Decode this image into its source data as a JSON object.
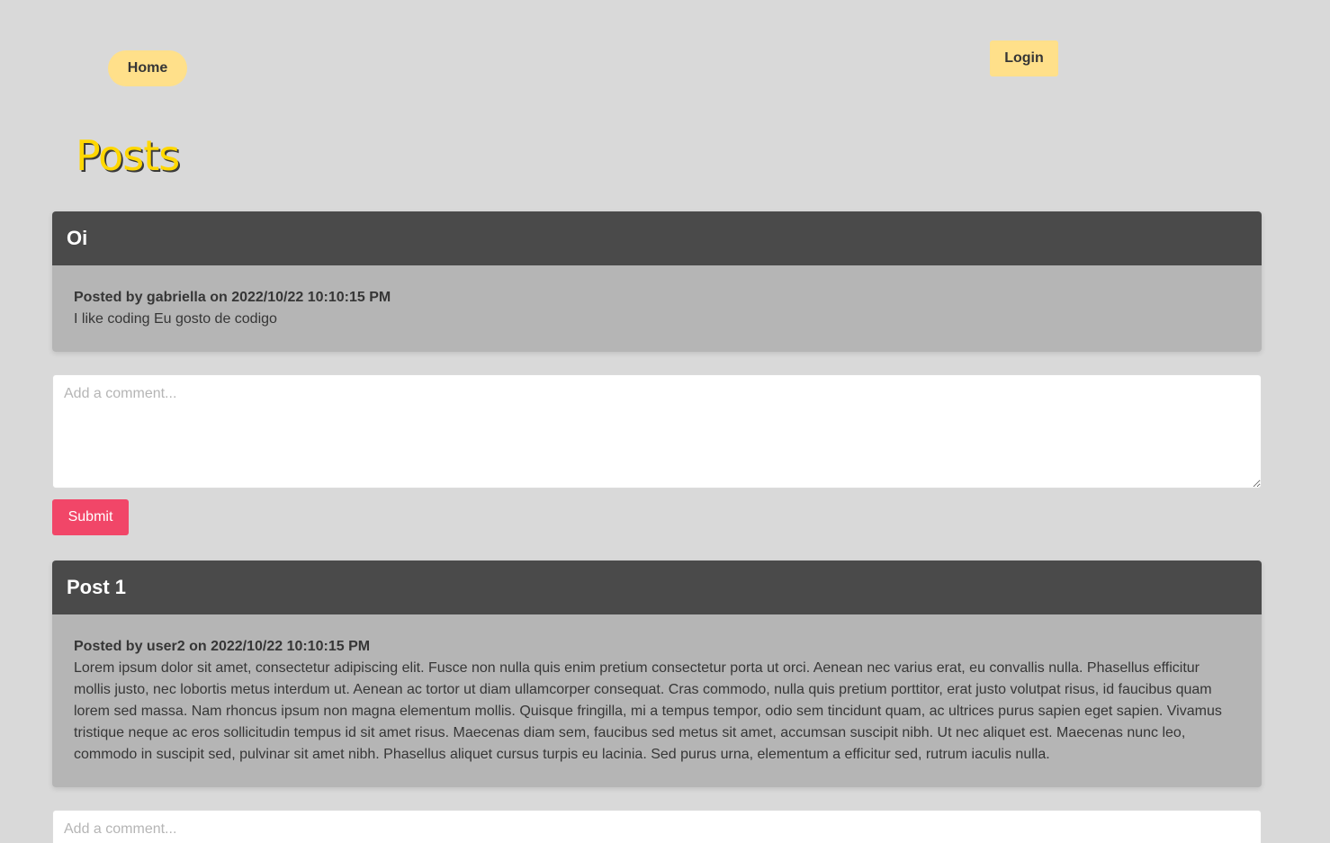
{
  "nav": {
    "home_label": "Home",
    "login_label": "Login"
  },
  "page_title": "Posts",
  "posts": [
    {
      "title": "Oi",
      "posted_by_prefix": "Posted by",
      "author": "gabriella",
      "on_word": "on",
      "date": "2022/10/22 10:10:15 PM",
      "content": "I like coding Eu gosto de codigo",
      "comment_placeholder": "Add a comment...",
      "submit_label": "Submit"
    },
    {
      "title": "Post 1",
      "posted_by_prefix": "Posted by",
      "author": "user2",
      "on_word": "on",
      "date": "2022/10/22 10:10:15 PM",
      "content": "Lorem ipsum dolor sit amet, consectetur adipiscing elit. Fusce non nulla quis enim pretium consectetur porta ut orci. Aenean nec varius erat, eu convallis nulla. Phasellus efficitur mollis justo, nec lobortis metus interdum ut. Aenean ac tortor ut diam ullamcorper consequat. Cras commodo, nulla quis pretium porttitor, erat justo volutpat risus, id faucibus quam lorem sed massa. Nam rhoncus ipsum non magna elementum mollis. Quisque fringilla, mi a tempus tempor, odio sem tincidunt quam, ac ultrices purus sapien eget sapien. Vivamus tristique neque ac eros sollicitudin tempus id sit amet risus. Maecenas diam sem, faucibus sed metus sit amet, accumsan suscipit nibh. Ut nec aliquet est. Maecenas nunc leo, commodo in suscipit sed, pulvinar sit amet nibh. Phasellus aliquet cursus turpis eu lacinia. Sed purus urna, elementum a efficitur sed, rutrum iaculis nulla.",
      "comment_placeholder": "Add a comment..."
    }
  ],
  "colors": {
    "background": "#d9d9d9",
    "nav_button": "#ffe08a",
    "title": "#ffd700",
    "post_header": "#4a4a4a",
    "post_body": "#b5b5b5",
    "submit_button": "#f14668"
  }
}
